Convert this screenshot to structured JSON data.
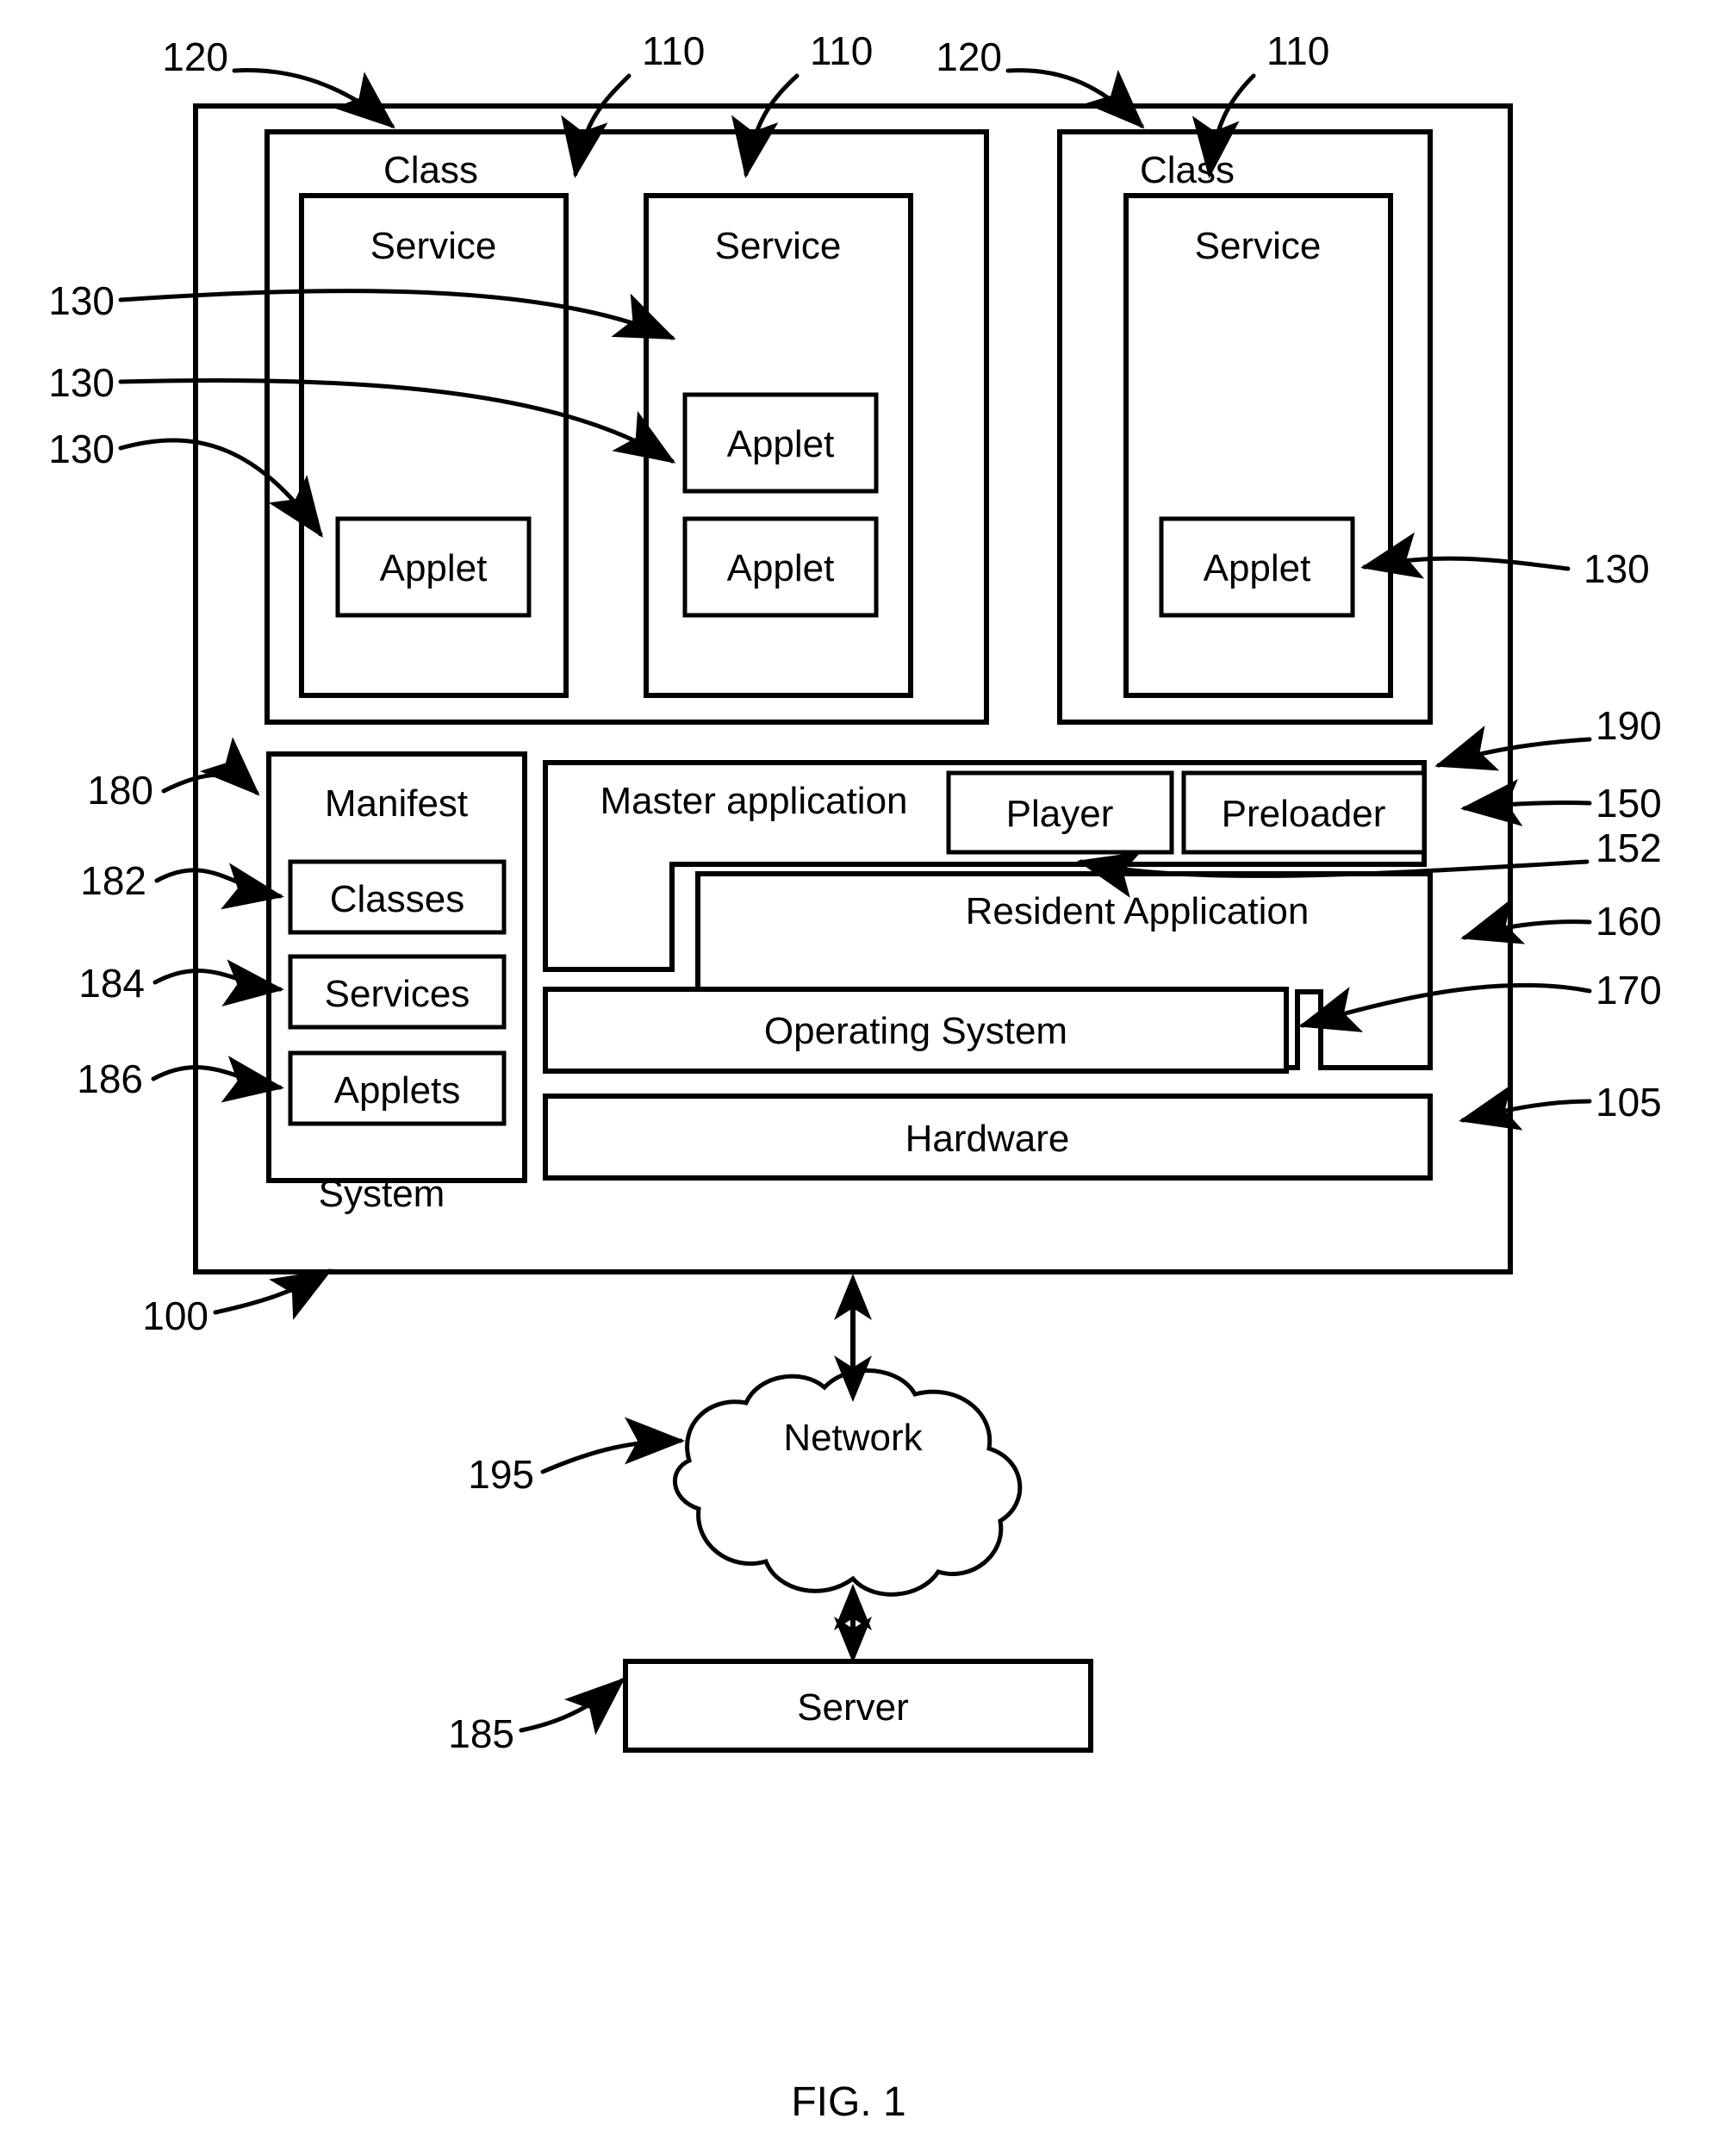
{
  "figure": {
    "caption": "FIG. 1"
  },
  "diagram": {
    "type": "patent-block-diagram",
    "system": {
      "label": "System",
      "ref": "100"
    },
    "class_groups": [
      {
        "label": "Class",
        "ref": "120",
        "services": [
          {
            "label": "Service",
            "ref": "110",
            "applets": [
              {
                "label": "Applet",
                "ref": "130"
              }
            ]
          },
          {
            "label": "Service",
            "ref": "110",
            "applets": [
              {
                "label": "Applet",
                "ref": "130"
              },
              {
                "label": "Applet",
                "ref": "130"
              }
            ]
          }
        ]
      },
      {
        "label": "Class",
        "ref": "120",
        "services": [
          {
            "label": "Service",
            "ref": "110",
            "applets": [
              {
                "label": "Applet",
                "ref": "130"
              }
            ]
          }
        ]
      }
    ],
    "manifest": {
      "label": "Manifest",
      "ref": "180",
      "entries": [
        {
          "label": "Classes",
          "ref": "182"
        },
        {
          "label": "Services",
          "ref": "184"
        },
        {
          "label": "Applets",
          "ref": "186"
        }
      ]
    },
    "stack": {
      "master_application": {
        "label": "Master application",
        "ref": "190"
      },
      "player": {
        "label": "Player",
        "ref": "152"
      },
      "preloader": {
        "label": "Preloader",
        "ref": "150"
      },
      "resident_application": {
        "label": "Resident Application",
        "ref": "160"
      },
      "operating_system": {
        "label": "Operating System",
        "ref": "170"
      },
      "hardware": {
        "label": "Hardware",
        "ref": "105"
      }
    },
    "network": {
      "label": "Network",
      "ref": "195"
    },
    "server": {
      "label": "Server",
      "ref": "185"
    }
  }
}
